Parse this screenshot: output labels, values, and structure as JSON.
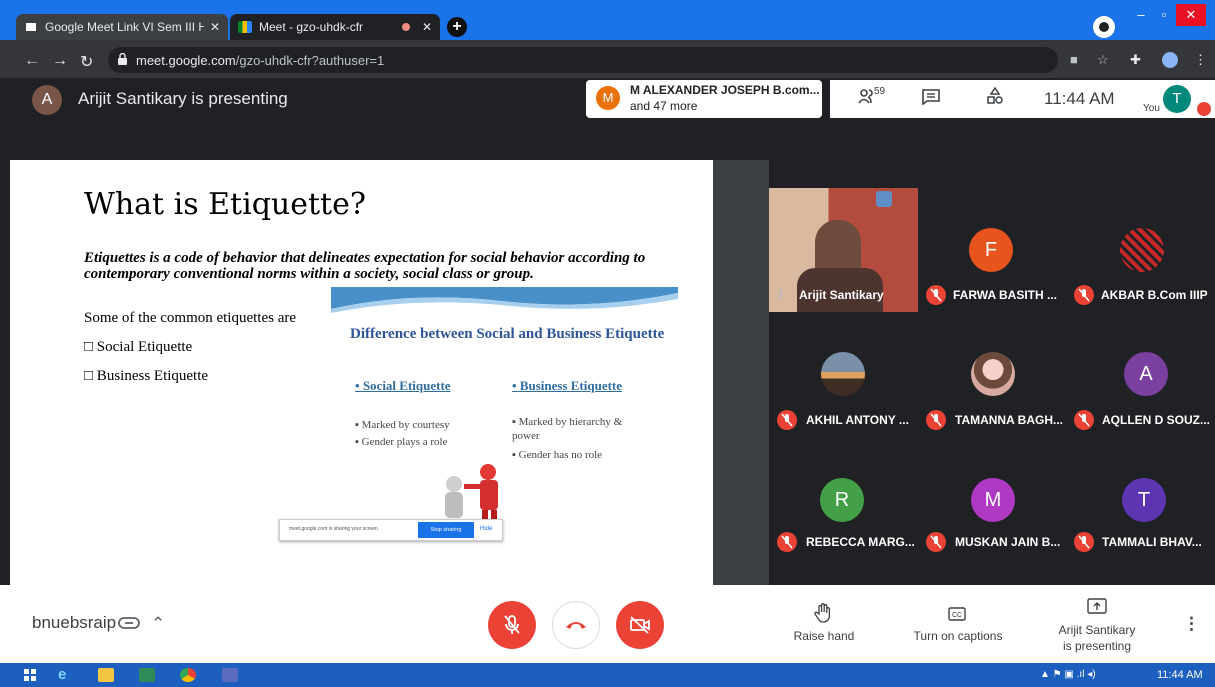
{
  "browser": {
    "tabs": [
      {
        "title": "Google Meet Link VI Sem III H &"
      },
      {
        "title": "Meet - gzo-uhdk-cfr"
      }
    ],
    "url_host": "meet.google.com",
    "url_path": "/gzo-uhdk-cfr?authuser=1"
  },
  "meet": {
    "presenter_initial": "A",
    "presenter_text": "Arijit Santikary is presenting",
    "notification": {
      "initial": "M",
      "line1": "M ALEXANDER JOSEPH B.com...",
      "line2": "and 47 more"
    },
    "participant_count": "59",
    "time": "11:44 AM",
    "you_label": "You",
    "self_initial": "T",
    "meeting_code": "bnuebsraip"
  },
  "slide": {
    "title": "What is Etiquette?",
    "definition": "Etiquettes is a code of behavior that delineates expectation for social behavior according to contemporary conventional norms within a society, social class or group.",
    "intro": "Some of the common etiquettes are",
    "bullets": [
      "□ Social Etiquette",
      "□ Business Etiquette"
    ],
    "inner": {
      "title": "Difference between Social and Business Etiquette",
      "col1_heading": "Social Etiquette",
      "col1_items": [
        "Marked by courtesy",
        "Gender plays a role"
      ],
      "col2_heading": "Business Etiquette",
      "col2_items": [
        "Marked by hierarchy & power",
        "Gender has no role"
      ]
    },
    "share_bar": {
      "text": "meet.google.com is sharing your screen.",
      "stop": "Stop sharing",
      "hide": "Hide"
    }
  },
  "participants": [
    {
      "name": "Arijit Santikary",
      "initial": "",
      "color": "",
      "kind": "video"
    },
    {
      "name": "FARWA BASITH ...",
      "initial": "F",
      "color": "#e8541e",
      "kind": "initial"
    },
    {
      "name": "AKBAR B.Com IIIP",
      "initial": "",
      "color": "#c62828",
      "kind": "image"
    },
    {
      "name": "AKHIL ANTONY ...",
      "initial": "",
      "color": "#6d4c41",
      "kind": "image"
    },
    {
      "name": "TAMANNA BAGH...",
      "initial": "",
      "color": "#d7a9a0",
      "kind": "image"
    },
    {
      "name": "AQLLEN D SOUZ...",
      "initial": "A",
      "color": "#7b3fa0",
      "kind": "initial"
    },
    {
      "name": "REBECCA MARG...",
      "initial": "R",
      "color": "#43a047",
      "kind": "initial"
    },
    {
      "name": "MUSKAN JAIN B...",
      "initial": "M",
      "color": "#b039c4",
      "kind": "initial"
    },
    {
      "name": "TAMMALI BHAV...",
      "initial": "T",
      "color": "#5e35b1",
      "kind": "initial"
    }
  ],
  "controls": {
    "raise_hand": "Raise hand",
    "captions": "Turn on captions",
    "presenting_line1": "Arijit Santikary",
    "presenting_line2": "is presenting"
  },
  "taskbar": {
    "time": "11:44 AM"
  },
  "colors": {
    "meet_red": "#ea4335",
    "chrome_blue": "#1a73e8",
    "dark_bg": "#202124"
  }
}
